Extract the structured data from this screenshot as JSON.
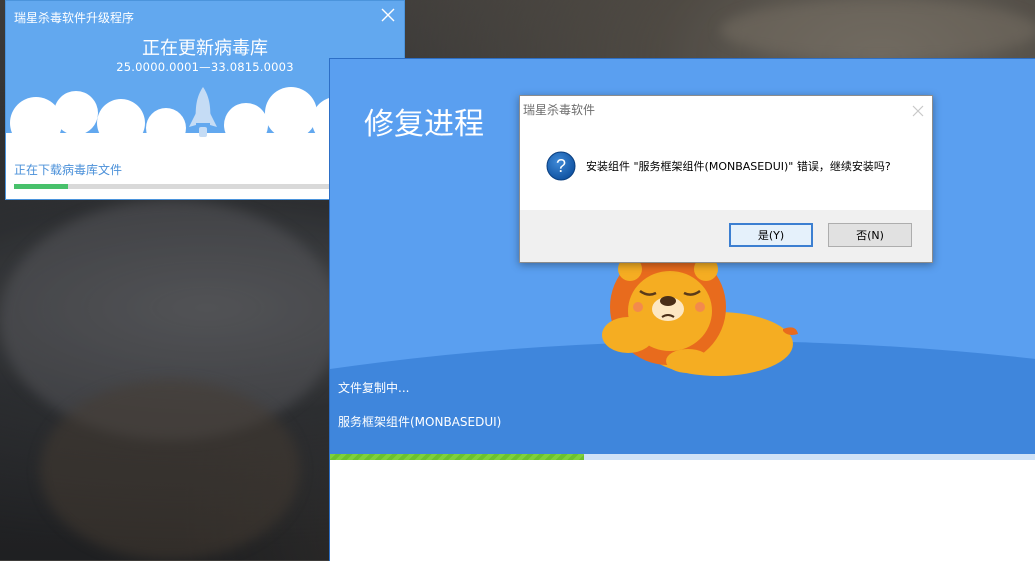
{
  "updater": {
    "title": "瑞星杀毒软件升级程序",
    "headline": "正在更新病毒库",
    "version": "25.0000.0001—33.0815.0003",
    "status": "正在下载病毒库文件",
    "progress_pct": 14,
    "icons": {
      "close": "close-icon",
      "rocket": "rocket-icon"
    }
  },
  "repair": {
    "heading": "修复进程",
    "copy_status": "文件复制中...",
    "component": "服务框架组件(MONBASEDUI)",
    "progress_pct": 36,
    "colors": {
      "background": "#5a9ff0",
      "progress": "#7fd13b"
    },
    "icons": {
      "mascot": "sleeping-lion-mascot"
    }
  },
  "dialog": {
    "title": "瑞星杀毒软件",
    "message": "安装组件 \"服务框架组件(MONBASEDUI)\" 错误，继续安装吗?",
    "yes_label": "是(Y)",
    "no_label": "否(N)",
    "icons": {
      "question": "question-icon",
      "close": "close-icon"
    }
  }
}
